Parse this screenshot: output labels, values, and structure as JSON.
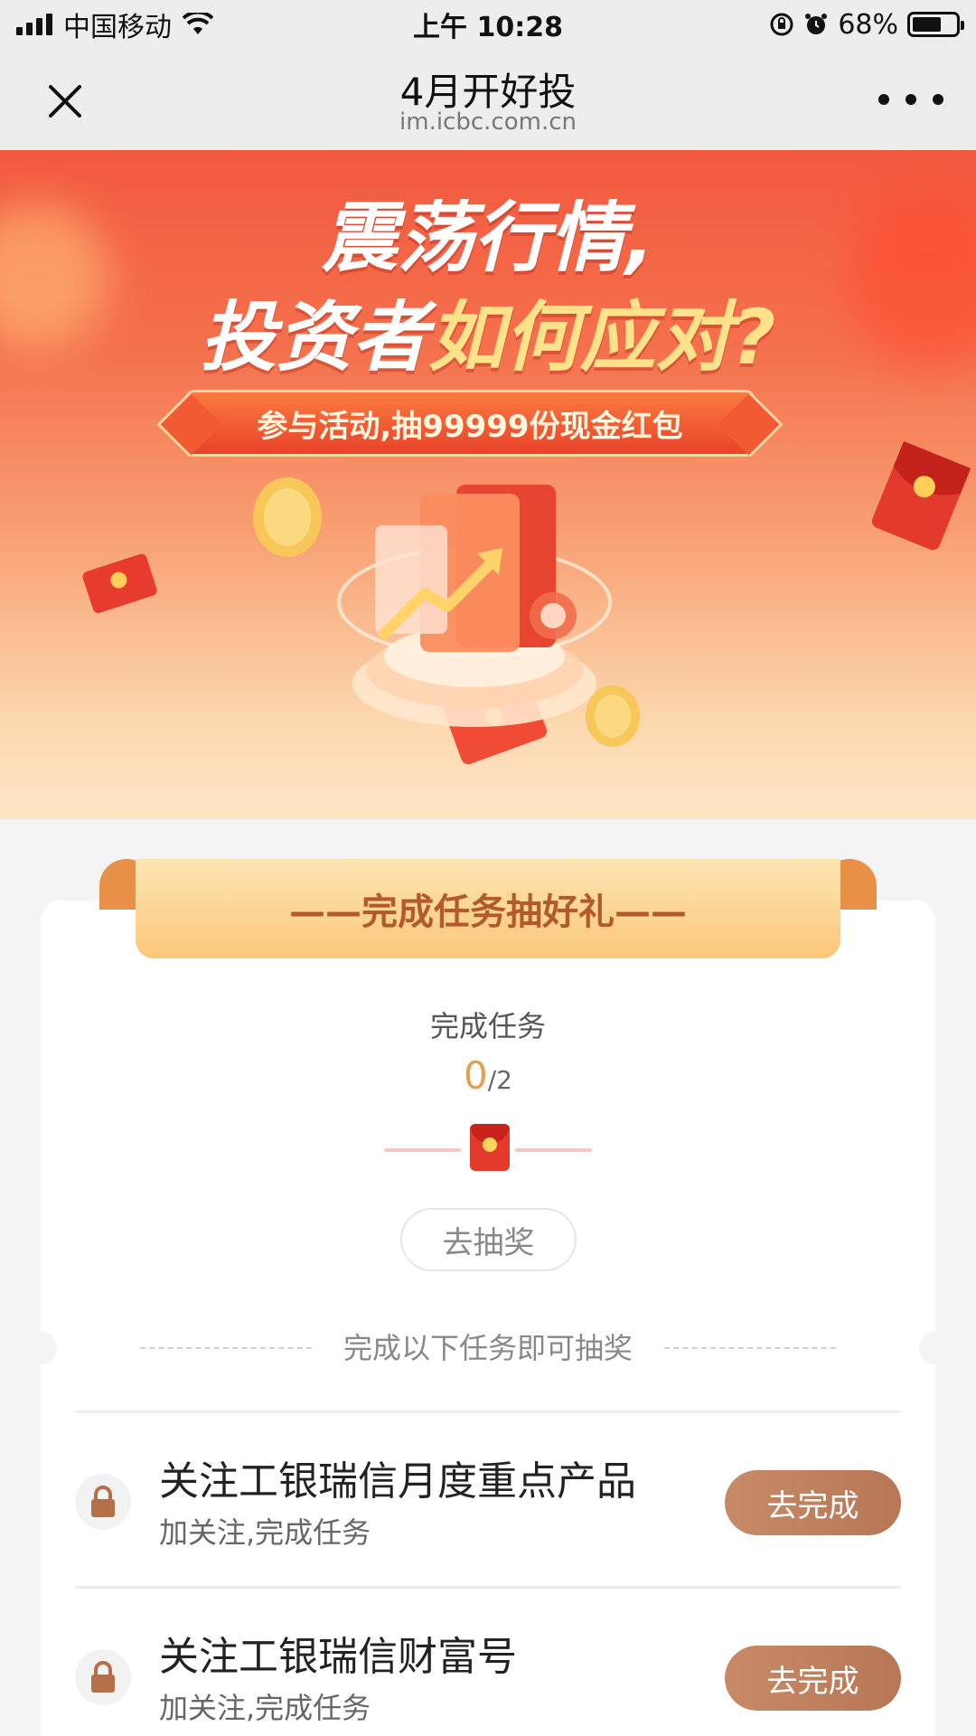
{
  "status_bar": {
    "carrier": "中国移动",
    "time": "上午 10:28",
    "battery": "68%",
    "battery_level": 0.68
  },
  "nav": {
    "title": "4月开好投",
    "subtitle": "im.icbc.com.cn"
  },
  "banner": {
    "line1": "震荡行情,",
    "line2_prefix": "投资者",
    "line2_highlight": "如何应对?",
    "promo": "参与活动,抽99999份现金红包"
  },
  "task_card": {
    "ribbon_title": "——完成任务抽好礼——",
    "progress_label": "完成任务",
    "progress_done": "0",
    "progress_total": "/2",
    "draw_button": "去抽奖",
    "divider_text": "完成以下任务即可抽奖",
    "tasks": [
      {
        "title": "关注工银瑞信月度重点产品",
        "subtitle": "加关注,完成任务",
        "button": "去完成"
      },
      {
        "title": "关注工银瑞信财富号",
        "subtitle": "加关注,完成任务",
        "button": "去完成"
      }
    ]
  },
  "colors": {
    "banner_top": "#f2593f",
    "accent_orange": "#e0a050",
    "task_button": "#c88a66",
    "ribbon_text": "#b35a2a"
  }
}
